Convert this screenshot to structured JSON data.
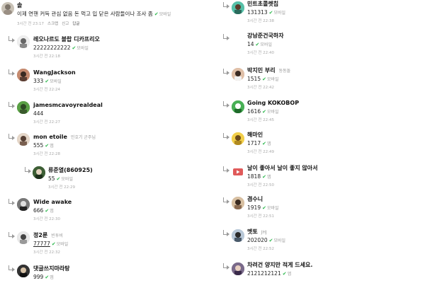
{
  "top_comment": {
    "author": "솔",
    "text": "이제 연핸 커득 관심 없음 돈 먹고 입 닫은 사람들이나 조사 좀",
    "device": "모바일",
    "time": "3시간 전 23:17",
    "actions": [
      "스크랩",
      "신고"
    ],
    "reply_label": "답글"
  },
  "left_replies": [
    {
      "author": "레오나르도 블랍 디카프리오",
      "sub": "",
      "text": "22222222222",
      "device": "모바일",
      "time": "3시간 전 22:18"
    },
    {
      "author": "WangJackson",
      "sub": "",
      "text": "333",
      "device": "모바일",
      "time": "3시간 전 22:24"
    },
    {
      "author": "jamesmcavoyrealdeal",
      "sub": "",
      "text": "444",
      "device": "",
      "time": "3시간 전 22:27"
    },
    {
      "author": "mon etoile",
      "sub": "민호기 군주님",
      "text": "555",
      "device": "앱",
      "time": "3시간 전 22:28"
    },
    {
      "author": "류준열(860925)",
      "sub": "",
      "text": "55",
      "device": "모바일",
      "time": "3시간 전 22:29"
    },
    {
      "author": "Wide awake",
      "sub": "",
      "text": "666",
      "device": "앱",
      "time": "3시간 전 22:30"
    },
    {
      "author": "정2룬",
      "sub": "빈투비",
      "text": "77777",
      "device": "모바일",
      "time": "3시간 전 22:32"
    },
    {
      "author": "댓글쓰지마라탕",
      "sub": "",
      "text": "999",
      "device": "앱",
      "time": ""
    }
  ],
  "right_replies": [
    {
      "author": "민트초콜렛칩",
      "sub": "",
      "text": "131313",
      "device": "모바일",
      "time": "3시간 전 22:38"
    },
    {
      "author": "강남준건국하자",
      "sub": "",
      "text": "14",
      "device": "모바일",
      "time": "3시간 전 22:40"
    },
    {
      "author": "박지민 부리",
      "sub": "동동돌",
      "text": "1515",
      "device": "모바일",
      "time": "3시간 전 22:42"
    },
    {
      "author": "Going KOKOBOP",
      "sub": "",
      "text": "1616",
      "device": "모바일",
      "time": "3시간 전 22:45"
    },
    {
      "author": "해마인",
      "sub": "",
      "text": "1717",
      "device": "앱",
      "time": "3시간 전 22:49"
    },
    {
      "author": "날이 좋아서 날이 좋지 않아서",
      "sub": "",
      "text": "1818",
      "device": "앱",
      "time": "3시간 전 22:50"
    },
    {
      "author": "겸수니",
      "sub": "",
      "text": "1919",
      "device": "모바일",
      "time": "3시간 전 22:51"
    },
    {
      "author": "멧토",
      "sub": "JHJ",
      "text": "202020",
      "device": "모바일",
      "time": "3시간 전 22:52"
    },
    {
      "author": "차려건 양지만 적게 드세요.",
      "sub": "",
      "text": "2121212121",
      "device": "앱",
      "time": ""
    }
  ],
  "colors": {
    "check": "#2db84d",
    "meta": "#aaaaaa",
    "arrow": "#9a9a9a"
  }
}
